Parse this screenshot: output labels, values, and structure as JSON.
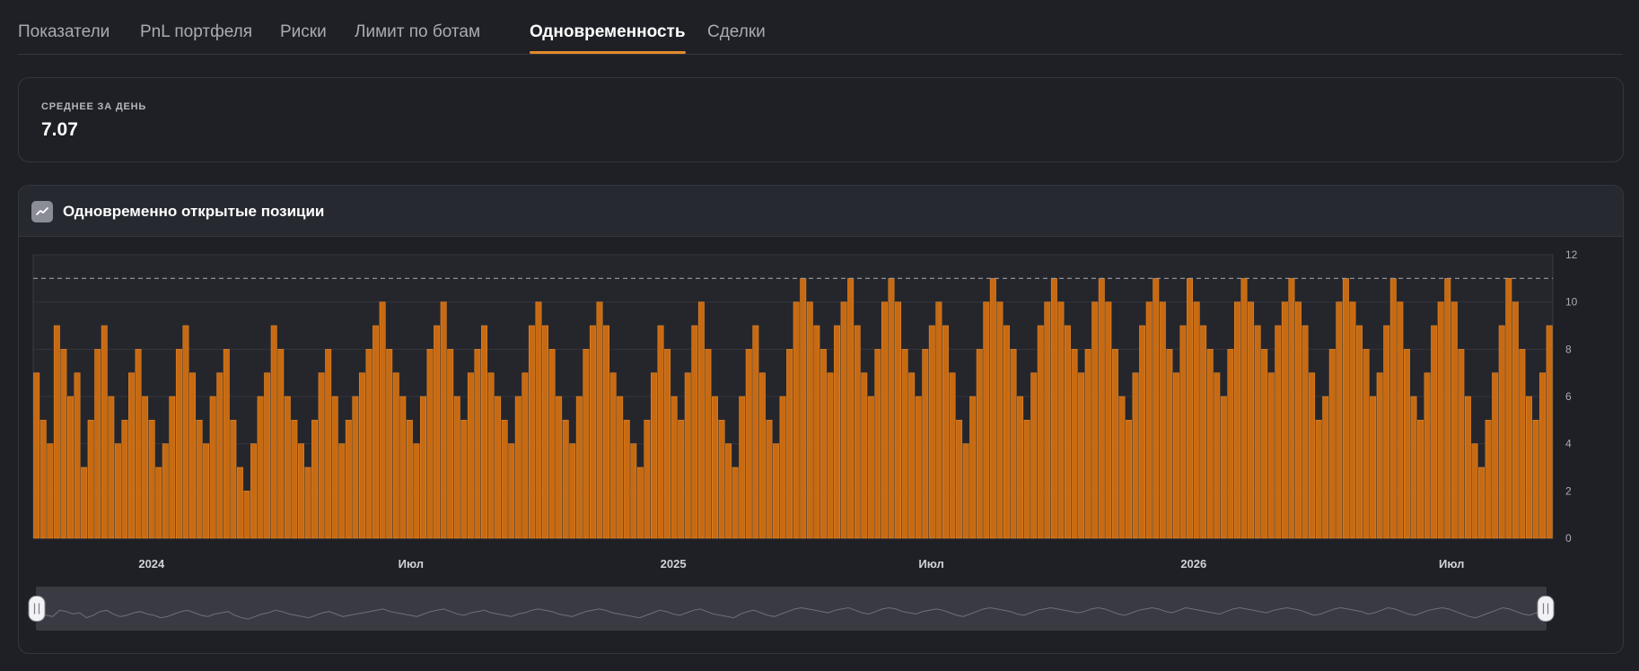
{
  "tabs": [
    {
      "label": "Показатели",
      "active": false
    },
    {
      "label": "PnL портфеля",
      "active": false
    },
    {
      "label": "Риски",
      "active": false
    },
    {
      "label": "Лимит по ботам",
      "active": false
    },
    {
      "label": "Одновременность",
      "active": true
    },
    {
      "label": "Сделки",
      "active": false
    }
  ],
  "summary": {
    "label": "СРЕДНЕЕ ЗА ДЕНЬ",
    "value": "7.07"
  },
  "chart_panel": {
    "title": "Одновременно открытые позиции",
    "icon": "line-chart-icon"
  },
  "colors": {
    "bar": "#c86a12",
    "bar_edge": "#e0862a",
    "accent": "#e28a2c",
    "limit_line": "#9a9ca6"
  },
  "chart_data": {
    "type": "bar",
    "title": "",
    "xlabel": "",
    "ylabel": "",
    "ylim": [
      0,
      12
    ],
    "y_ticks": [
      0,
      2,
      4,
      6,
      8,
      10,
      12
    ],
    "limit_value": 11,
    "x_tick_labels": [
      "2024",
      "Июл",
      "2025",
      "Июл",
      "2026",
      "Июл"
    ],
    "x_range": [
      "2023-10-10",
      "2026-09-10"
    ],
    "x_ticks": [
      "2024-01-01",
      "2024-07-01",
      "2025-01-01",
      "2025-07-01",
      "2026-01-01",
      "2026-07-01"
    ],
    "series": [
      {
        "values": [
          7,
          5,
          4,
          9,
          8,
          6,
          7,
          3,
          5,
          8,
          9,
          6,
          4,
          5,
          7,
          8,
          6,
          5,
          3,
          4,
          6,
          8,
          9,
          7,
          5,
          4,
          6,
          7,
          8,
          5,
          3,
          2,
          4,
          6,
          7,
          9,
          8,
          6,
          5,
          4,
          3,
          5,
          7,
          8,
          6,
          4,
          5,
          6,
          7,
          8,
          9,
          10,
          8,
          7,
          6,
          5,
          4,
          6,
          8,
          9,
          10,
          8,
          6,
          5,
          7,
          8,
          9,
          7,
          6,
          5,
          4,
          6,
          7,
          9,
          10,
          9,
          8,
          6,
          5,
          4,
          6,
          8,
          9,
          10,
          9,
          7,
          6,
          5,
          4,
          3,
          5,
          7,
          9,
          8,
          6,
          5,
          7,
          9,
          10,
          8,
          6,
          5,
          4,
          3,
          6,
          8,
          9,
          7,
          5,
          4,
          6,
          8,
          10,
          11,
          10,
          9,
          8,
          7,
          9,
          10,
          11,
          9,
          7,
          6,
          8,
          10,
          11,
          10,
          8,
          7,
          6,
          8,
          9,
          10,
          9,
          7,
          5,
          4,
          6,
          8,
          10,
          11,
          10,
          9,
          8,
          6,
          5,
          7,
          9,
          10,
          11,
          10,
          9,
          8,
          7,
          8,
          10,
          11,
          10,
          8,
          6,
          5,
          7,
          9,
          10,
          11,
          10,
          8,
          7,
          9,
          11,
          10,
          9,
          8,
          7,
          6,
          8,
          10,
          11,
          10,
          9,
          8,
          7,
          9,
          10,
          11,
          10,
          9,
          7,
          5,
          6,
          8,
          10,
          11,
          10,
          9,
          8,
          6,
          7,
          9,
          11,
          10,
          8,
          6,
          5,
          7,
          9,
          10,
          11,
          10,
          8,
          6,
          4,
          3,
          5,
          7,
          9,
          11,
          10,
          8,
          6,
          5,
          7,
          9
        ]
      }
    ]
  }
}
